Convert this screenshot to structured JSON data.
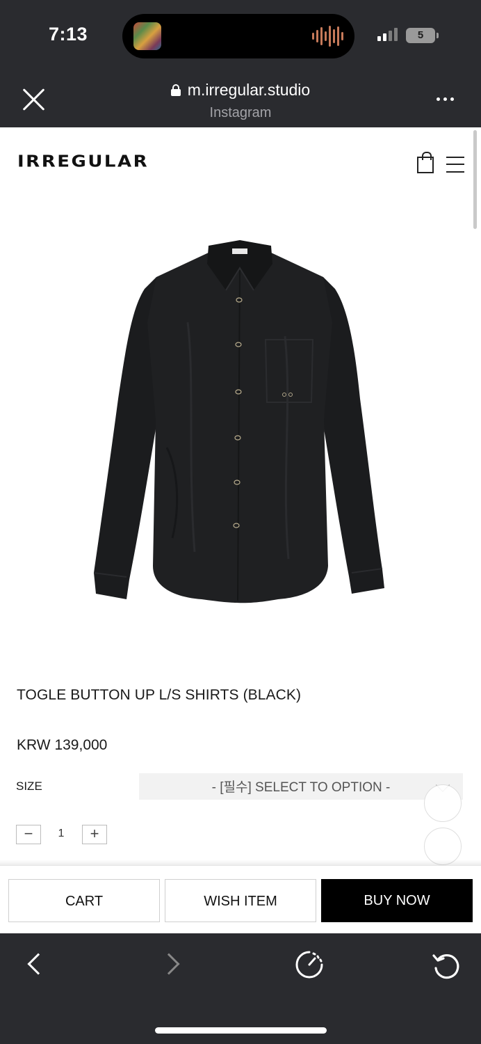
{
  "status_bar": {
    "time": "7:13",
    "battery": "5",
    "island_activity": "audio-waveform-icon"
  },
  "browser": {
    "url": "m.irregular.studio",
    "source": "Instagram",
    "icons": {
      "close": "close-icon",
      "lock": "lock-icon",
      "more": "more-icon"
    }
  },
  "site": {
    "logo": "IRREGULAR",
    "icons": {
      "cart": "shopping-bag-icon",
      "menu": "menu-icon"
    }
  },
  "product": {
    "name": "TOGLE BUTTON UP L/S SHIRTS (BLACK)",
    "price": "KRW 139,000",
    "size_label": "SIZE",
    "size_select_placeholder": "- [필수] SELECT TO OPTION -",
    "quantity": "1",
    "qty_minus": "−",
    "qty_plus": "+"
  },
  "actions": {
    "cart": "CART",
    "wish": "WISH ITEM",
    "buy": "BUY NOW"
  },
  "toolbar": {
    "icons": [
      "back-icon",
      "forward-icon",
      "speed-icon",
      "refresh-icon"
    ]
  },
  "colors": {
    "chrome": "#2a2b2f",
    "buy_button": "#000000",
    "page": "#ffffff"
  }
}
